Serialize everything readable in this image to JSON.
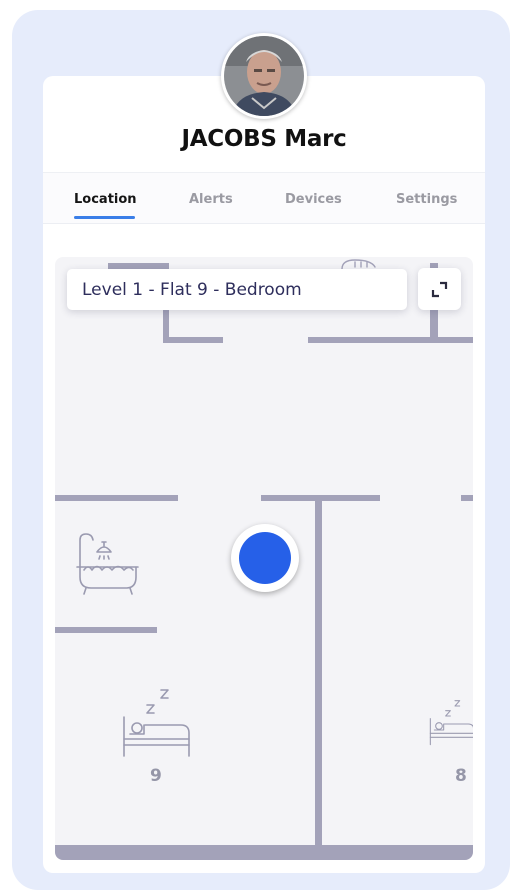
{
  "user": {
    "name": "JACOBS Marc"
  },
  "tabs": [
    {
      "label": "Location",
      "active": true
    },
    {
      "label": "Alerts",
      "active": false
    },
    {
      "label": "Devices",
      "active": false
    },
    {
      "label": "Settings",
      "active": false
    }
  ],
  "map": {
    "location_label": "Level 1 - Flat 9 - Bedroom",
    "room_numbers": [
      "9",
      "8"
    ],
    "icons": [
      "bathtub-icon",
      "bed-icon",
      "expand-icon"
    ]
  },
  "colors": {
    "accent": "#3a7ee8",
    "marker": "#2660e8",
    "wall": "#a3a2b9",
    "map_bg": "#f4f4f7",
    "frame_bg": "#e6ecfb"
  }
}
